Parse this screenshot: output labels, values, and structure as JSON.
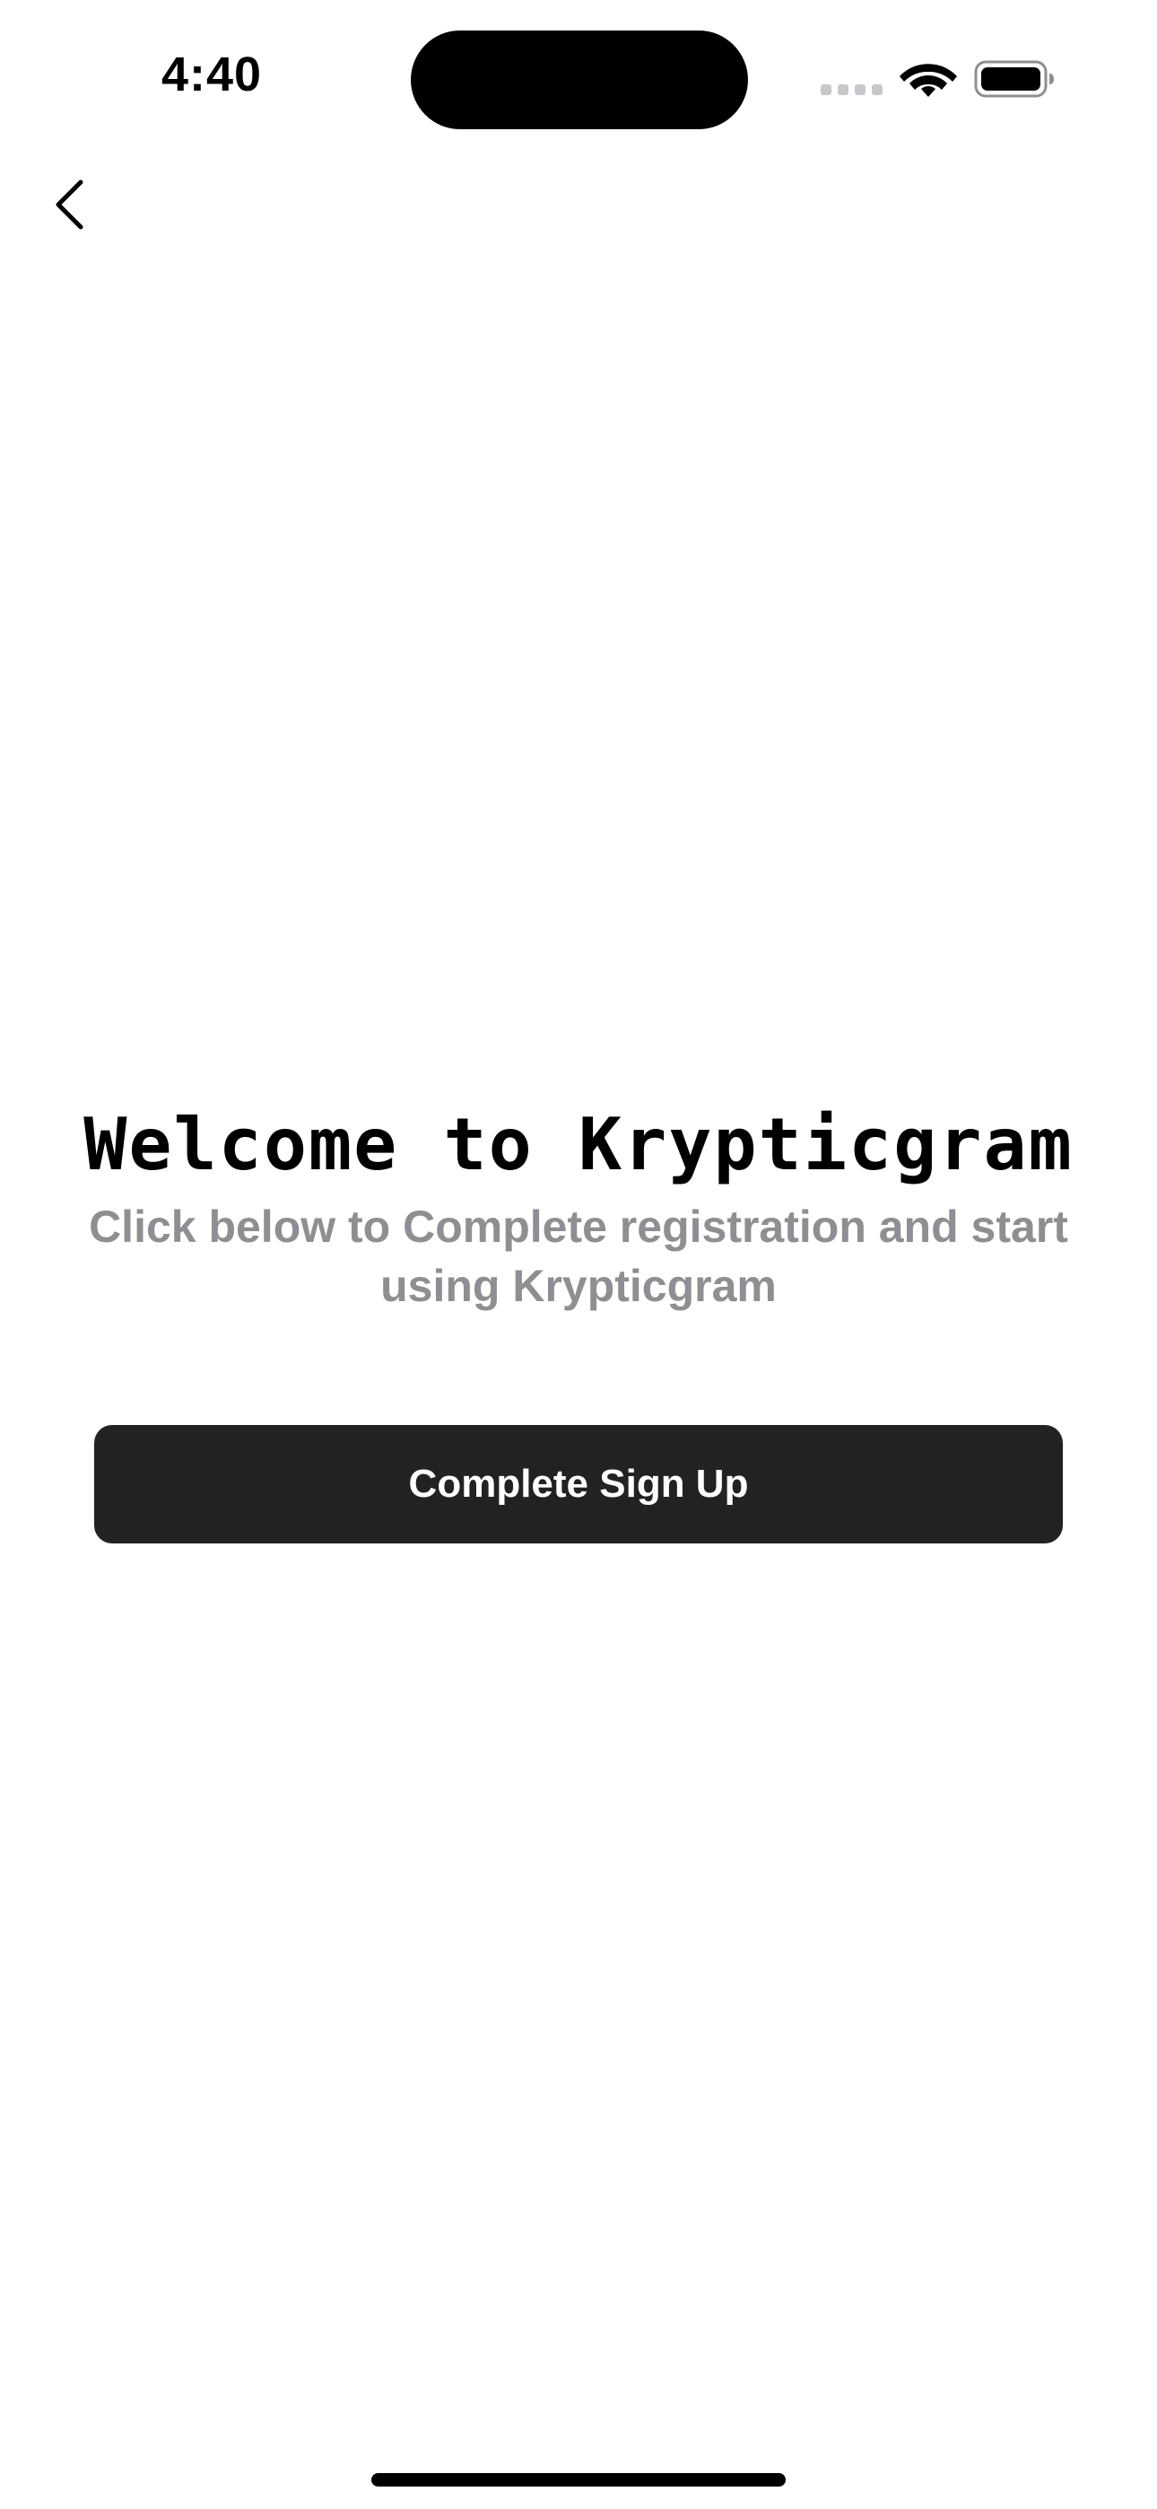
{
  "status_bar": {
    "time": "4:40",
    "icons": [
      "cellular-signal-icon",
      "wifi-icon",
      "battery-icon"
    ]
  },
  "nav": {
    "back_icon": "chevron-left-icon"
  },
  "main": {
    "title": "Welcome to Krypticgram",
    "subtitle": "Click below to Complete registration and start using Krypticgram",
    "cta_label": "Complete Sign Up"
  },
  "colors": {
    "background": "#ffffff",
    "title_text": "#000000",
    "subtitle_text": "#8e8e93",
    "button_background": "#222222",
    "button_text": "#ffffff"
  }
}
